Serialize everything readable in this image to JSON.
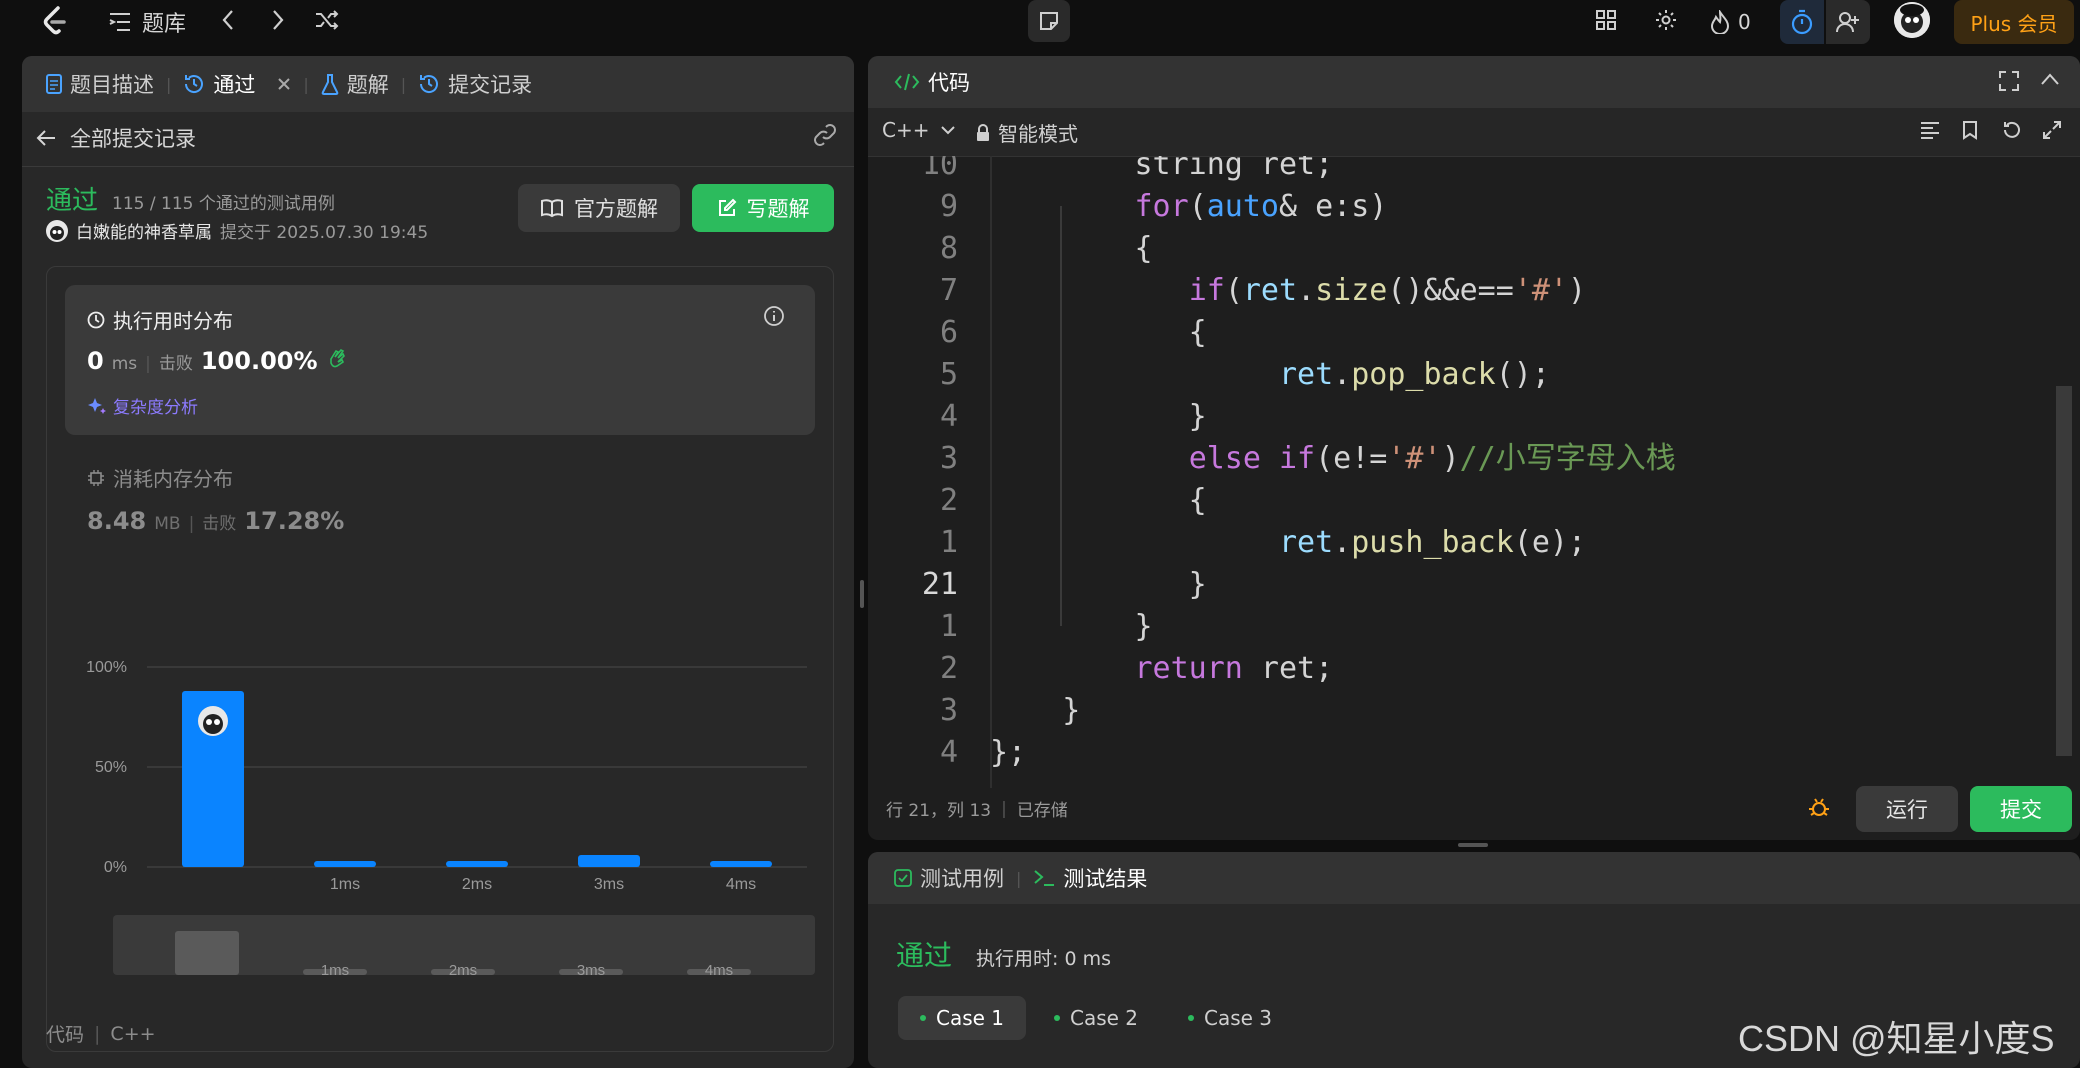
{
  "topbar": {
    "problem_bank": "题库",
    "fire_count": "0",
    "plus_label": "Plus 会员"
  },
  "left": {
    "tabs": [
      {
        "label": "题目描述"
      },
      {
        "label": "通过"
      },
      {
        "label": "题解"
      },
      {
        "label": "提交记录"
      }
    ],
    "back_label": "全部提交记录",
    "status": "通过",
    "cases_passed": "115 / 115 个通过的测试用例",
    "user_name": "白嫩能的神香草属",
    "submitted_at": "提交于 2025.07.30 19:45",
    "official_solution": "官方题解",
    "write_solution": "写题解",
    "runtime": {
      "title": "执行用时分布",
      "value": "0",
      "unit": "ms",
      "beats_label": "击败",
      "beats_value": "100.00%",
      "complexity": "复杂度分析"
    },
    "memory": {
      "title": "消耗内存分布",
      "value": "8.48",
      "unit": "MB",
      "beats_label": "击败",
      "beats_value": "17.28%"
    },
    "code_footer": "代码",
    "code_lang": "C++"
  },
  "chart_data": {
    "type": "bar",
    "categories": [
      "0ms",
      "1ms",
      "2ms",
      "3ms",
      "4ms"
    ],
    "values": [
      88,
      3,
      3,
      6,
      3
    ],
    "tick_labels": [
      "",
      "1ms",
      "2ms",
      "3ms",
      "4ms"
    ],
    "y_ticks": [
      "0%",
      "50%",
      "100%"
    ],
    "ylim": [
      0,
      100
    ],
    "highlight_index": 0,
    "bar_color": "#0a84ff",
    "overview_values": [
      88,
      3,
      3,
      6,
      3
    ],
    "overview_labels": [
      "",
      "1ms",
      "2ms",
      "3ms",
      "4ms"
    ]
  },
  "right": {
    "header": "代码",
    "lang": "C++",
    "mode": "智能模式",
    "status_line": "行 21，列 13",
    "saved": "已存储",
    "run": "运行",
    "submit": "提交",
    "code": [
      {
        "ln": "10",
        "tokens": [
          {
            "t": "        ",
            "c": "plain"
          },
          {
            "t": "string ret;",
            "c": "plain"
          }
        ]
      },
      {
        "ln": "9",
        "tokens": [
          {
            "t": "        ",
            "c": "plain"
          },
          {
            "t": "for",
            "c": "kw"
          },
          {
            "t": "(",
            "c": "plain"
          },
          {
            "t": "auto",
            "c": "ty"
          },
          {
            "t": "& e:s)",
            "c": "plain"
          }
        ]
      },
      {
        "ln": "8",
        "tokens": [
          {
            "t": "        {",
            "c": "plain"
          }
        ]
      },
      {
        "ln": "7",
        "tokens": [
          {
            "t": "           ",
            "c": "plain"
          },
          {
            "t": "if",
            "c": "kw"
          },
          {
            "t": "(",
            "c": "plain"
          },
          {
            "t": "ret",
            "c": "var"
          },
          {
            "t": ".",
            "c": "plain"
          },
          {
            "t": "size",
            "c": "fn"
          },
          {
            "t": "()&&e==",
            "c": "plain"
          },
          {
            "t": "'#'",
            "c": "str"
          },
          {
            "t": ")",
            "c": "plain"
          }
        ]
      },
      {
        "ln": "6",
        "tokens": [
          {
            "t": "           {",
            "c": "plain"
          }
        ]
      },
      {
        "ln": "5",
        "tokens": [
          {
            "t": "                ",
            "c": "plain"
          },
          {
            "t": "ret",
            "c": "var"
          },
          {
            "t": ".",
            "c": "plain"
          },
          {
            "t": "pop_back",
            "c": "fn"
          },
          {
            "t": "();",
            "c": "plain"
          }
        ]
      },
      {
        "ln": "4",
        "tokens": [
          {
            "t": "           }",
            "c": "plain"
          }
        ]
      },
      {
        "ln": "3",
        "tokens": [
          {
            "t": "           ",
            "c": "plain"
          },
          {
            "t": "else if",
            "c": "kw"
          },
          {
            "t": "(e!=",
            "c": "plain"
          },
          {
            "t": "'#'",
            "c": "str"
          },
          {
            "t": ")",
            "c": "plain"
          },
          {
            "t": "//小写字母入栈",
            "c": "cm"
          }
        ]
      },
      {
        "ln": "2",
        "tokens": [
          {
            "t": "           {",
            "c": "plain"
          }
        ]
      },
      {
        "ln": "1",
        "tokens": [
          {
            "t": "                ",
            "c": "plain"
          },
          {
            "t": "ret",
            "c": "var"
          },
          {
            "t": ".",
            "c": "plain"
          },
          {
            "t": "push_back",
            "c": "fn"
          },
          {
            "t": "(e);",
            "c": "plain"
          }
        ]
      },
      {
        "ln": "21",
        "tokens": [
          {
            "t": "           }",
            "c": "plain"
          }
        ],
        "current": true
      },
      {
        "ln": "1",
        "tokens": [
          {
            "t": "        }",
            "c": "plain"
          }
        ]
      },
      {
        "ln": "2",
        "tokens": [
          {
            "t": "        ",
            "c": "plain"
          },
          {
            "t": "return",
            "c": "kw"
          },
          {
            "t": " ret;",
            "c": "plain"
          }
        ]
      },
      {
        "ln": "3",
        "tokens": [
          {
            "t": "    }",
            "c": "plain"
          }
        ]
      },
      {
        "ln": "4",
        "tokens": [
          {
            "t": "};",
            "c": "plain"
          }
        ]
      }
    ]
  },
  "bottom": {
    "tab_cases": "测试用例",
    "tab_result": "测试结果",
    "status": "通过",
    "exec_time": "执行用时: 0 ms",
    "cases": [
      "Case 1",
      "Case 2",
      "Case 3"
    ]
  },
  "watermark": "CSDN @知星小度S"
}
